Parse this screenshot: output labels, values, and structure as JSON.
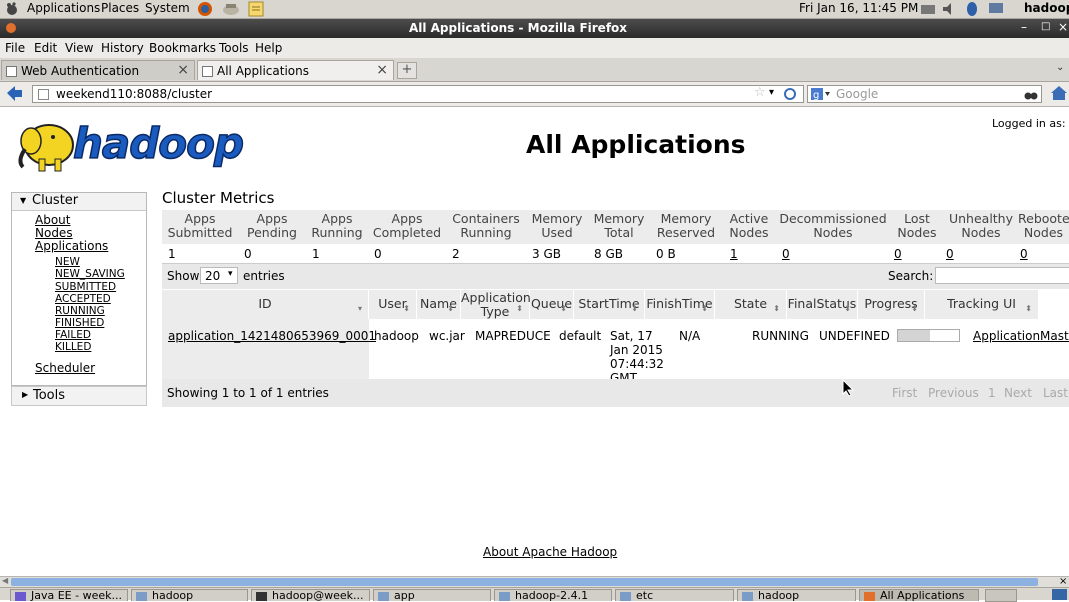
{
  "panel": {
    "menus": [
      "Applications",
      "Places",
      "System"
    ],
    "clock": "Fri Jan 16, 11:45 PM",
    "user": "hadoop"
  },
  "window": {
    "title": "All Applications - Mozilla Firefox"
  },
  "menubar": [
    "File",
    "Edit",
    "View",
    "History",
    "Bookmarks",
    "Tools",
    "Help"
  ],
  "tabs": [
    {
      "label": "Web Authentication"
    },
    {
      "label": "All Applications"
    }
  ],
  "navbar": {
    "url": "weekend110:8088/cluster",
    "search_placeholder": "Google"
  },
  "page": {
    "logo_text": "hadoop",
    "title": "All Applications",
    "logged_in": "Logged in as: dr.w",
    "sidebar": {
      "cluster_label": "Cluster",
      "links": [
        "About",
        "Nodes",
        "Applications"
      ],
      "states": [
        "NEW",
        "NEW_SAVING",
        "SUBMITTED",
        "ACCEPTED",
        "RUNNING",
        "FINISHED",
        "FAILED",
        "KILLED"
      ],
      "scheduler": "Scheduler",
      "tools_label": "Tools"
    },
    "metrics": {
      "heading": "Cluster Metrics",
      "headers": [
        [
          "Apps",
          "Submitted"
        ],
        [
          "Apps",
          "Pending"
        ],
        [
          "Apps",
          "Running"
        ],
        [
          "Apps",
          "Completed"
        ],
        [
          "Containers",
          "Running"
        ],
        [
          "Memory",
          "Used"
        ],
        [
          "Memory",
          "Total"
        ],
        [
          "Memory",
          "Reserved"
        ],
        [
          "Active",
          "Nodes"
        ],
        [
          "Decommissioned",
          "Nodes"
        ],
        [
          "Lost",
          "Nodes"
        ],
        [
          "Unhealthy",
          "Nodes"
        ],
        [
          "Rebooted",
          "Nodes"
        ]
      ],
      "values": [
        "1",
        "0",
        "1",
        "0",
        "2",
        "3 GB",
        "8 GB",
        "0 B",
        "1",
        "0",
        "0",
        "0",
        "0"
      ]
    },
    "table": {
      "show_label": "Show",
      "entries_value": "20",
      "entries_label": "entries",
      "search_label": "Search:",
      "headers": [
        [
          "ID"
        ],
        [
          "User"
        ],
        [
          "Name"
        ],
        [
          "Application",
          "Type"
        ],
        [
          "Queue"
        ],
        [
          "StartTime"
        ],
        [
          "FinishTime"
        ],
        [
          "State"
        ],
        [
          "FinalStatus"
        ],
        [
          "Progress"
        ],
        [
          "Tracking UI"
        ]
      ],
      "rows": [
        {
          "id": "application_1421480653969_0001",
          "user": "hadoop",
          "name": "wc.jar",
          "type": "MAPREDUCE",
          "queue": "default",
          "start": [
            "Sat, 17",
            "Jan 2015",
            "07:44:32",
            "GMT"
          ],
          "finish": "N/A",
          "state": "RUNNING",
          "final_status": "UNDEFINED",
          "progress": 0.52,
          "tracking": "ApplicationMaster"
        }
      ],
      "info": "Showing 1 to 1 of 1 entries",
      "pager": [
        "First",
        "Previous",
        "1",
        "Next",
        "Last"
      ]
    },
    "footer_link": "About Apache Hadoop"
  },
  "taskbar": [
    "Java EE - week...",
    "hadoop",
    "hadoop@week...",
    "app",
    "hadoop-2.4.1",
    "etc",
    "hadoop",
    "All Applications"
  ]
}
